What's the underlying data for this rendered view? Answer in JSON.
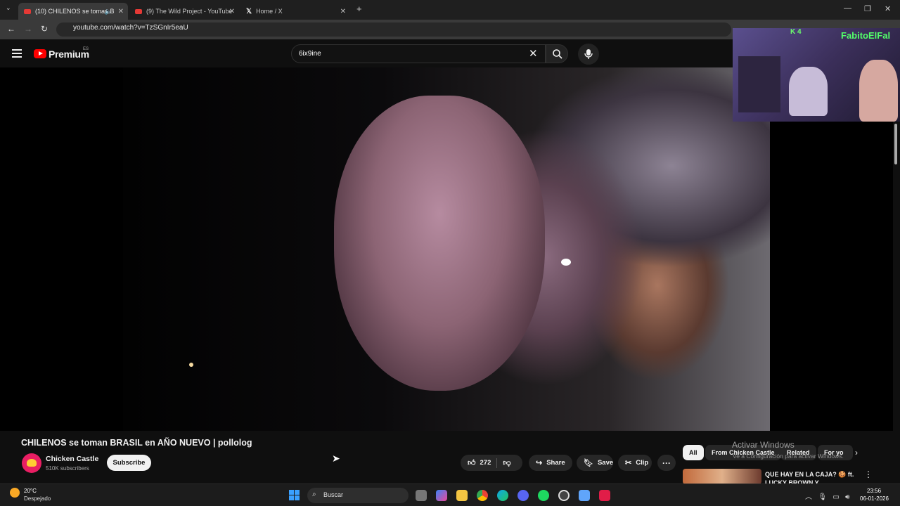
{
  "browser": {
    "tabs": [
      {
        "label": "(10) CHILENOS se toman B",
        "active": true
      },
      {
        "label": "(9) The Wild Project - YouTube",
        "active": false
      },
      {
        "label": "Home / X",
        "active": false
      }
    ],
    "url": "youtube.com/watch?v=TzSGnIr5eaU"
  },
  "header": {
    "logo": "Premium",
    "region": "ES",
    "search_value": "6ix9ine"
  },
  "overlay": {
    "streamer_name": "FabitoElFal",
    "badge": "K 4"
  },
  "video": {
    "title": "CHILENOS se toman BRASIL en AÑO NUEVO | pollolog",
    "channel": "Chicken Castle",
    "subscribers": "510K subscribers",
    "subscribe_label": "Subscribe",
    "likes": "272",
    "share_label": "Share",
    "save_label": "Save",
    "clip_label": "Clip",
    "more_label": "···"
  },
  "chips": [
    "All",
    "From Chicken Castle",
    "Related",
    "For yo"
  ],
  "watermark": {
    "line1": "Activar Windows",
    "line2": "Ve a Configuración para activar Windows."
  },
  "recommendation": {
    "title": "QUE HAY EN LA CAJA? 🍪 ft. LUCKY BROWN Y"
  },
  "taskbar": {
    "temperature": "20°C",
    "weather": "Despejado",
    "search_label": "Buscar",
    "time": "23:56",
    "date": "06-01-2026"
  }
}
